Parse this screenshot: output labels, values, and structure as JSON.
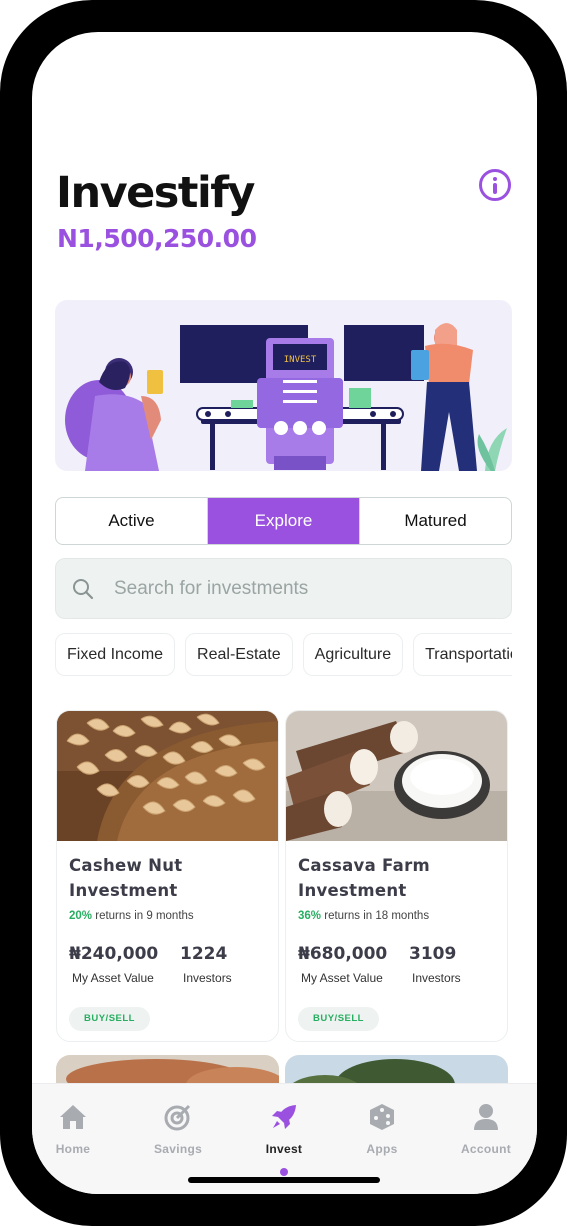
{
  "app": {
    "title": "Investify",
    "balance": "N1,500,250.00"
  },
  "tabs": [
    {
      "label": "Active",
      "active": false
    },
    {
      "label": "Explore",
      "active": true
    },
    {
      "label": "Matured",
      "active": false
    }
  ],
  "search": {
    "placeholder": "Search for investments",
    "value": ""
  },
  "banner": {
    "screen_text": "INVEST"
  },
  "categories": [
    "Fixed Income",
    "Real-Estate",
    "Agriculture",
    "Transportation"
  ],
  "investments": [
    {
      "title": "Cashew Nut Investment",
      "returns_pct": "20%",
      "returns_text": "returns in 9 months",
      "asset_value": "₦240,000",
      "asset_value_label": "My Asset Value",
      "investors": "1224",
      "investors_label": "Investors",
      "action_label": "BUY/SELL"
    },
    {
      "title": "Cassava Farm Investment",
      "returns_pct": "36%",
      "returns_text": "returns in 18 months",
      "asset_value": "₦680,000",
      "asset_value_label": "My Asset Value",
      "investors": "3109",
      "investors_label": "Investors",
      "action_label": "BUY/SELL"
    }
  ],
  "nav": [
    {
      "label": "Home",
      "icon": "home-icon",
      "active": false
    },
    {
      "label": "Savings",
      "icon": "target-icon",
      "active": false
    },
    {
      "label": "Invest",
      "icon": "rocket-icon",
      "active": true
    },
    {
      "label": "Apps",
      "icon": "dice-icon",
      "active": false
    },
    {
      "label": "Account",
      "icon": "user-icon",
      "active": false
    }
  ],
  "colors": {
    "accent": "#9b51e0",
    "positive": "#27ae60",
    "tab_border": "#cfd6d6",
    "search_bg": "#eef2f1"
  }
}
